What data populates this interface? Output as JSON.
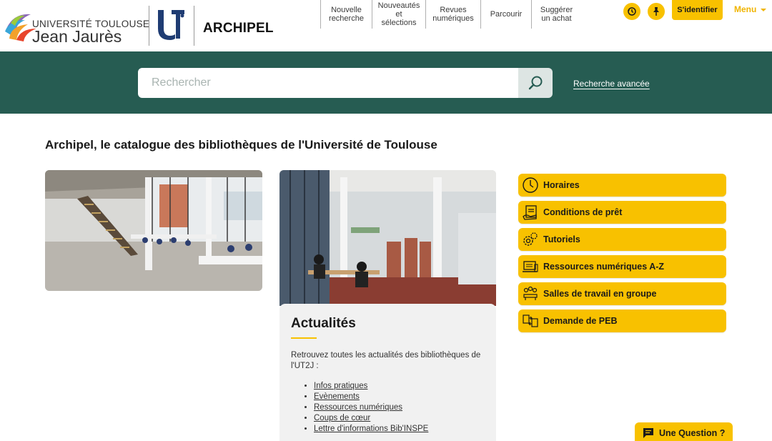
{
  "header": {
    "logo_line1": "UNIVERSITÉ TOULOUSE",
    "logo_line2": "Jean Jaurès",
    "brand": "ARCHIPEL",
    "nav": [
      {
        "label": "Nouvelle recherche"
      },
      {
        "label": "Nouveautés et sélections"
      },
      {
        "label": "Revues numériques"
      },
      {
        "label": "Parcourir"
      },
      {
        "label": "Suggérer un achat"
      }
    ],
    "login_label": "S'identifier",
    "menu_label": "Menu"
  },
  "search": {
    "placeholder": "Rechercher",
    "advanced_label": "Recherche avancée"
  },
  "main": {
    "title": "Archipel, le catalogue des bibliothèques de l'Université de Toulouse"
  },
  "news": {
    "title": "Actualités",
    "text": "Retrouvez toutes les actualités des bibliothèques de l'UT2J :",
    "links": [
      {
        "label": "Infos pratiques"
      },
      {
        "label": "Evènements"
      },
      {
        "label": "Ressources numériques"
      },
      {
        "label": "Coups de cœur"
      },
      {
        "label": "Lettre d'informations Bib'INSPE"
      }
    ]
  },
  "quick_links": [
    {
      "label": "Horaires",
      "icon": "clock-icon"
    },
    {
      "label": "Conditions de prêt",
      "icon": "loan-icon"
    },
    {
      "label": "Tutoriels",
      "icon": "gears-icon"
    },
    {
      "label": "Ressources numériques A-Z",
      "icon": "laptop-books-icon"
    },
    {
      "label": "Salles de travail en groupe",
      "icon": "group-icon"
    },
    {
      "label": "Demande de PEB",
      "icon": "exchange-icon"
    }
  ],
  "chat": {
    "label": "Une Question ?"
  },
  "colors": {
    "accent": "#f8c100",
    "band": "#265c52"
  }
}
